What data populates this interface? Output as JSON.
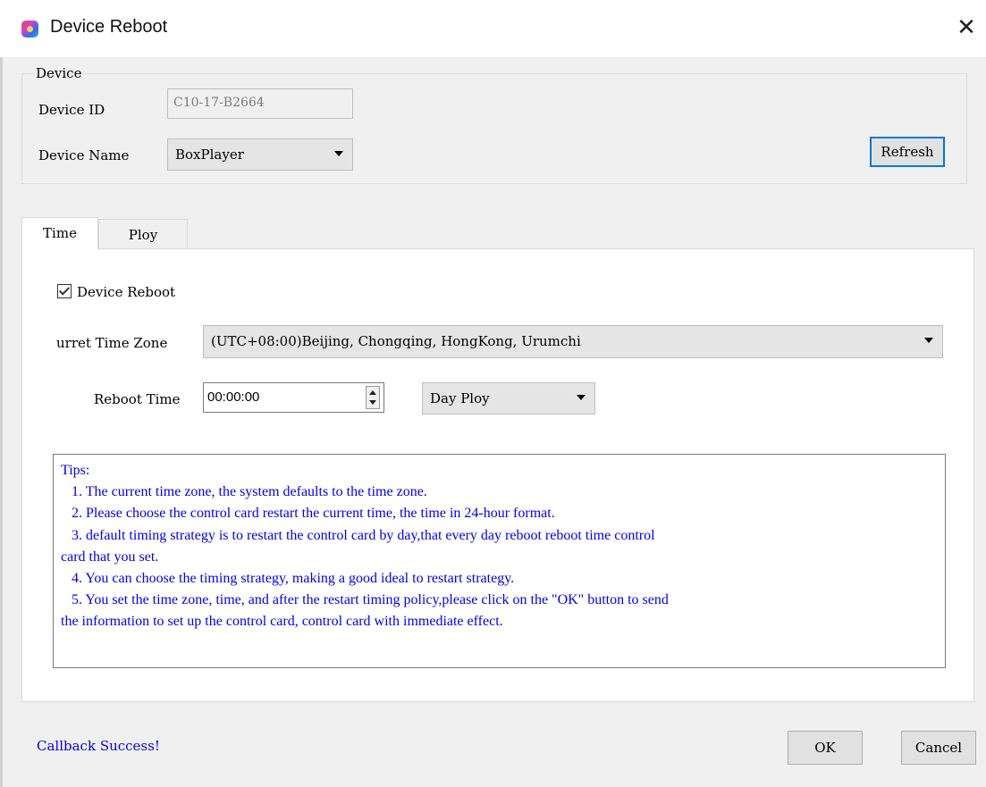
{
  "window": {
    "title": "Device Reboot",
    "close_glyph": "✕",
    "icon": "app-logo-icon"
  },
  "device_group": {
    "title": "Device",
    "device_id_label": "Device ID",
    "device_id_value": "C10-17-B2664",
    "device_name_label": "Device Name",
    "device_name_value": "BoxPlayer",
    "refresh_label": "Refresh"
  },
  "tabs": [
    {
      "label": "Time",
      "active": true
    },
    {
      "label": "Ploy",
      "active": false
    }
  ],
  "time_tab": {
    "reboot_checkbox_label": "Device Reboot",
    "reboot_checked": true,
    "time_zone_label": "urret Time Zone",
    "time_zone_value": "(UTC+08:00)Beijing, Chongqing, HongKong, Urumchi",
    "reboot_time_label": "Reboot Time",
    "reboot_time_value": "00:00:00",
    "ploy_value": "Day Ploy"
  },
  "tips": {
    "heading": "Tips:",
    "lines": [
      "1. The current time zone, the system defaults to the time zone.",
      "2. Please choose the control card restart the current time, the time in 24-hour format.",
      "3. default timing strategy is to restart the control card by day,that every day reboot reboot time control",
      "card that you set.",
      "4. You can choose the timing strategy, making a good ideal to restart strategy.",
      "5. You set the time zone, time, and after the restart timing policy,please click on the \"OK\" button to send",
      "the information to set up the control card, control card with immediate effect."
    ]
  },
  "footer": {
    "status_text": "Callback Success!",
    "ok_label": "OK",
    "cancel_label": "Cancel"
  },
  "colors": {
    "tips_text": "#0000ee",
    "status_text": "#0000ee",
    "focus_border": "#0078d7"
  }
}
